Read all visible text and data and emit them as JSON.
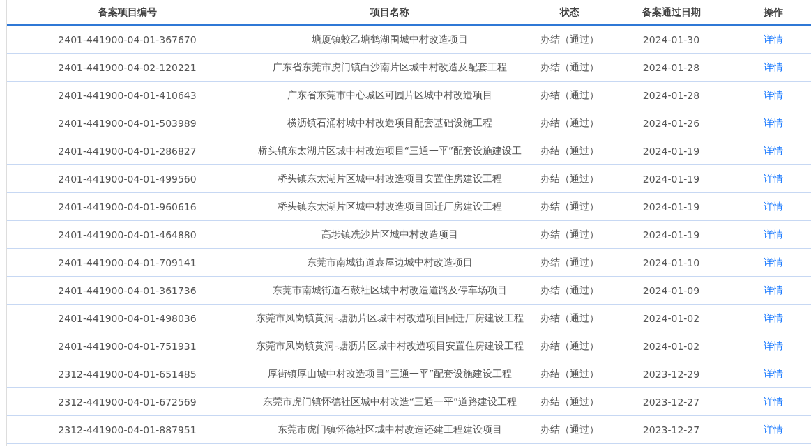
{
  "table": {
    "columns": [
      "备案项目编号",
      "项目名称",
      "状态",
      "备案通过日期",
      "操作"
    ],
    "rows": [
      {
        "code": "2401-441900-04-01-367670",
        "name": "塘厦镇蛟乙塘鹤湖围城中村改造项目",
        "status": "办结（通过）",
        "date": "2024-01-30",
        "action": "详情"
      },
      {
        "code": "2401-441900-04-02-120221",
        "name": "广东省东莞市虎门镇白沙南片区城中村改造及配套工程",
        "status": "办结（通过）",
        "date": "2024-01-28",
        "action": "详情"
      },
      {
        "code": "2401-441900-04-01-410643",
        "name": "广东省东莞市中心城区可园片区城中村改造项目",
        "status": "办结（通过）",
        "date": "2024-01-28",
        "action": "详情"
      },
      {
        "code": "2401-441900-04-01-503989",
        "name": "横沥镇石涌村城中村改造项目配套基础设施工程",
        "status": "办结（通过）",
        "date": "2024-01-26",
        "action": "详情"
      },
      {
        "code": "2401-441900-04-01-286827",
        "name": "桥头镇东太湖片区城中村改造项目“三通一平”配套设施建设工",
        "status": "办结（通过）",
        "date": "2024-01-19",
        "action": "详情"
      },
      {
        "code": "2401-441900-04-01-499560",
        "name": "桥头镇东太湖片区城中村改造项目安置住房建设工程",
        "status": "办结（通过）",
        "date": "2024-01-19",
        "action": "详情"
      },
      {
        "code": "2401-441900-04-01-960616",
        "name": "桥头镇东太湖片区城中村改造项目回迁厂房建设工程",
        "status": "办结（通过）",
        "date": "2024-01-19",
        "action": "详情"
      },
      {
        "code": "2401-441900-04-01-464880",
        "name": "高埗镇冼沙片区城中村改造项目",
        "status": "办结（通过）",
        "date": "2024-01-19",
        "action": "详情"
      },
      {
        "code": "2401-441900-04-01-709141",
        "name": "东莞市南城街道袁屋边城中村改造项目",
        "status": "办结（通过）",
        "date": "2024-01-10",
        "action": "详情"
      },
      {
        "code": "2401-441900-04-01-361736",
        "name": "东莞市南城街道石鼓社区城中村改造道路及停车场项目",
        "status": "办结（通过）",
        "date": "2024-01-09",
        "action": "详情"
      },
      {
        "code": "2401-441900-04-01-498036",
        "name": "东莞市凤岗镇黄洞-塘沥片区城中村改造项目回迁厂房建设工程",
        "status": "办结（通过）",
        "date": "2024-01-02",
        "action": "详情"
      },
      {
        "code": "2401-441900-04-01-751931",
        "name": "东莞市凤岗镇黄洞-塘沥片区城中村改造项目安置住房建设工程",
        "status": "办结（通过）",
        "date": "2024-01-02",
        "action": "详情"
      },
      {
        "code": "2312-441900-04-01-651485",
        "name": "厚街镇厚山城中村改造项目“三通一平”配套设施建设工程",
        "status": "办结（通过）",
        "date": "2023-12-29",
        "action": "详情"
      },
      {
        "code": "2312-441900-04-01-672569",
        "name": "东莞市虎门镇怀德社区城中村改造“三通一平”道路建设工程",
        "status": "办结（通过）",
        "date": "2023-12-27",
        "action": "详情"
      },
      {
        "code": "2312-441900-04-01-887951",
        "name": "东莞市虎门镇怀德社区城中村改造还建工程建设项目",
        "status": "办结（通过）",
        "date": "2023-12-27",
        "action": "详情"
      }
    ]
  }
}
